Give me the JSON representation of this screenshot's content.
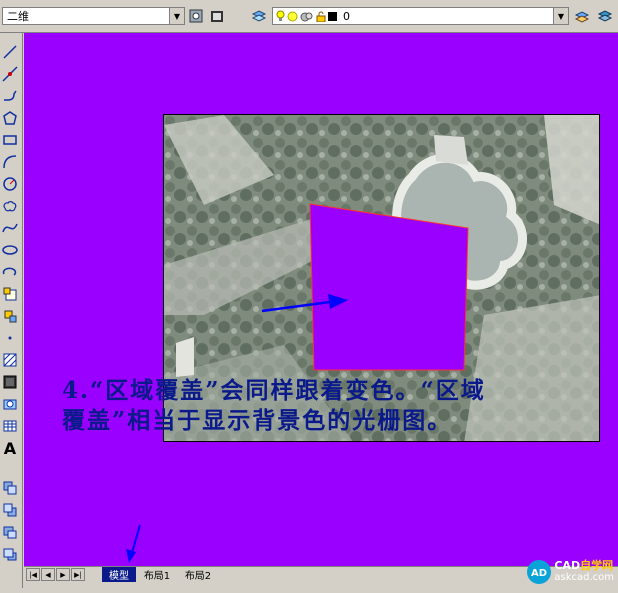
{
  "toolbar": {
    "view_select": "二维",
    "layer_value": "0"
  },
  "canvas": {
    "caption_line1": "4.“区域覆盖”会同样跟着变色。“区域",
    "caption_line2": "覆盖”相当于显示背景色的光栅图。"
  },
  "tabs": {
    "model": "模型",
    "layout1": "布局1",
    "layout2": "布局2"
  },
  "watermark": {
    "logo": "CAD",
    "site_cn": "自学网",
    "site": "askcad.com"
  },
  "colors": {
    "background": "#9900ff",
    "caption": "#0b1a8a",
    "arrow": "#0000ff"
  }
}
